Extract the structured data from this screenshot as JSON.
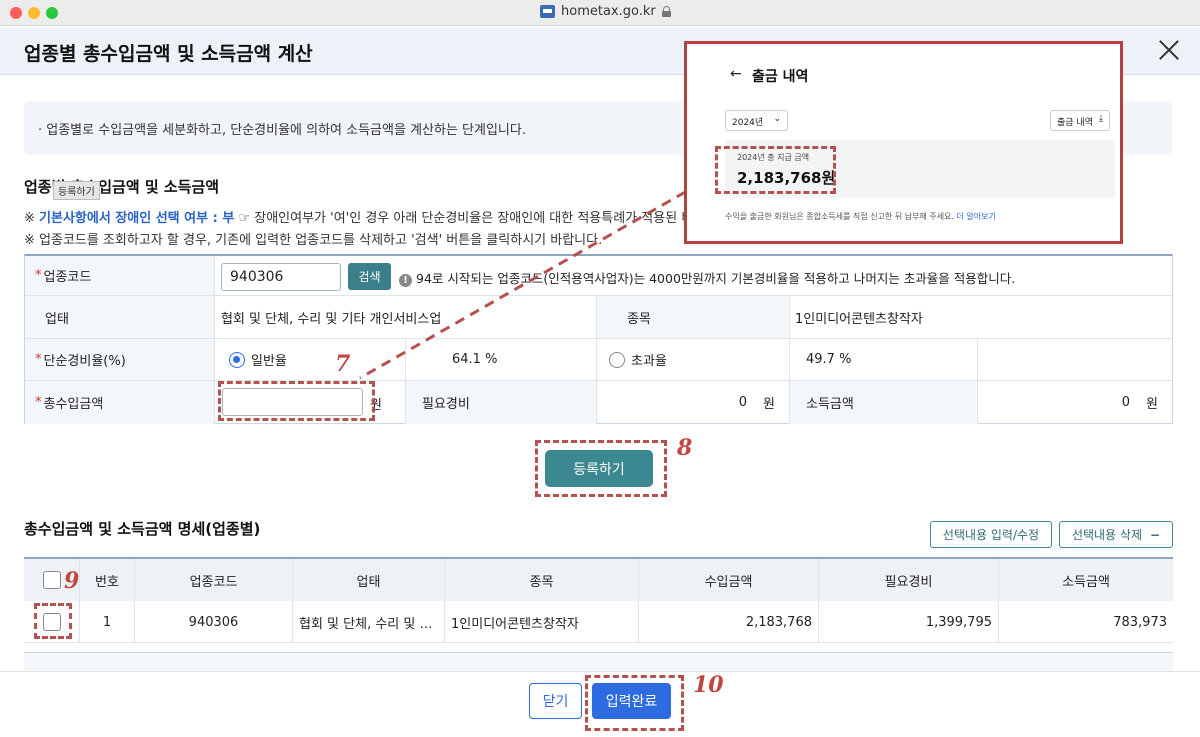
{
  "browser": {
    "url": "hometax.go.kr"
  },
  "modal": {
    "title": "업종별 총수입금액 및 소득금액 계산",
    "info": "· 업종별로 수입금액을 세분화하고, 단순경비율에 의하여 소득금액을 계산하는 단계입니다."
  },
  "section1": {
    "title": "업종별 총수입금액 및 소득금액",
    "tooltip": "등록하기",
    "note1_prefix": "※ ",
    "note1_blue": "기본사항에서 장애인 선택 여부 : 부",
    "note1_rest": " ☞ 장애인여부가 '여'인 경우 아래 단순경비율은 장애인에 대한 적용특례가 적용된 비",
    "note2": "※ 업종코드를 조회하고자 할 경우, 기존에 입력한 업종코드를 삭제하고 '검색' 버튼을 클릭하시기 바랍니다."
  },
  "form": {
    "industry_code_label": "업종코드",
    "industry_code_value": "940306",
    "search_button": "검색",
    "industry_code_hint": "94로 시작되는 업종코드(인적용역사업자)는 4000만원까지 기본경비율을 적용하고 나머지는 초과율을 적용합니다.",
    "business_type_label": "업태",
    "business_type_value": "협회 및 단체, 수리 및 기타 개인서비스업",
    "item_label": "종목",
    "item_value": "1인미디어콘텐츠창작자",
    "rate_label": "단순경비율(%)",
    "rate_general_label": "일반율",
    "rate_general_value": "64.1 %",
    "rate_excess_label": "초과율",
    "rate_excess_value": "49.7 %",
    "total_income_label": "총수입금액",
    "total_income_value": "",
    "won": "원",
    "expense_label": "필요경비",
    "expense_value": "0",
    "income_label": "소득금액",
    "income_value": "0"
  },
  "register_button": "등록하기",
  "section2": {
    "title": "총수입금액 및 소득금액 명세(업종별)",
    "edit_button": "선택내용 입력/수정",
    "delete_button": "선택내용 삭제",
    "delete_icon": "−"
  },
  "table": {
    "headers": [
      "번호",
      "업종코드",
      "업태",
      "종목",
      "수입금액",
      "필요경비",
      "소득금액"
    ],
    "rows": [
      {
        "no": "1",
        "code": "940306",
        "type": "협회 및 단체, 수리 및 …",
        "item": "1인미디어콘텐츠창작자",
        "revenue": "2,183,768",
        "expense": "1,399,795",
        "income": "783,973"
      }
    ]
  },
  "footer": {
    "close_button": "닫기",
    "done_button": "입력완료"
  },
  "annotations": {
    "n7": "7",
    "n8": "8",
    "n9": "9",
    "n10": "10"
  },
  "inset": {
    "title": "출금 내역",
    "back_icon": "←",
    "year": "2024년",
    "download": "출금 내역",
    "sum_label": "2024년 총 지급 금액",
    "sum_value": "2,183,768원",
    "note": "수익을 출금한 회원님은 종합소득세를 직접 신고한 뒤 납부해 주세요.",
    "note_link": "더 알아보기"
  },
  "colors": {
    "accent": "#2d6be0",
    "teal": "#3b8890",
    "annotation": "#b5524f"
  }
}
